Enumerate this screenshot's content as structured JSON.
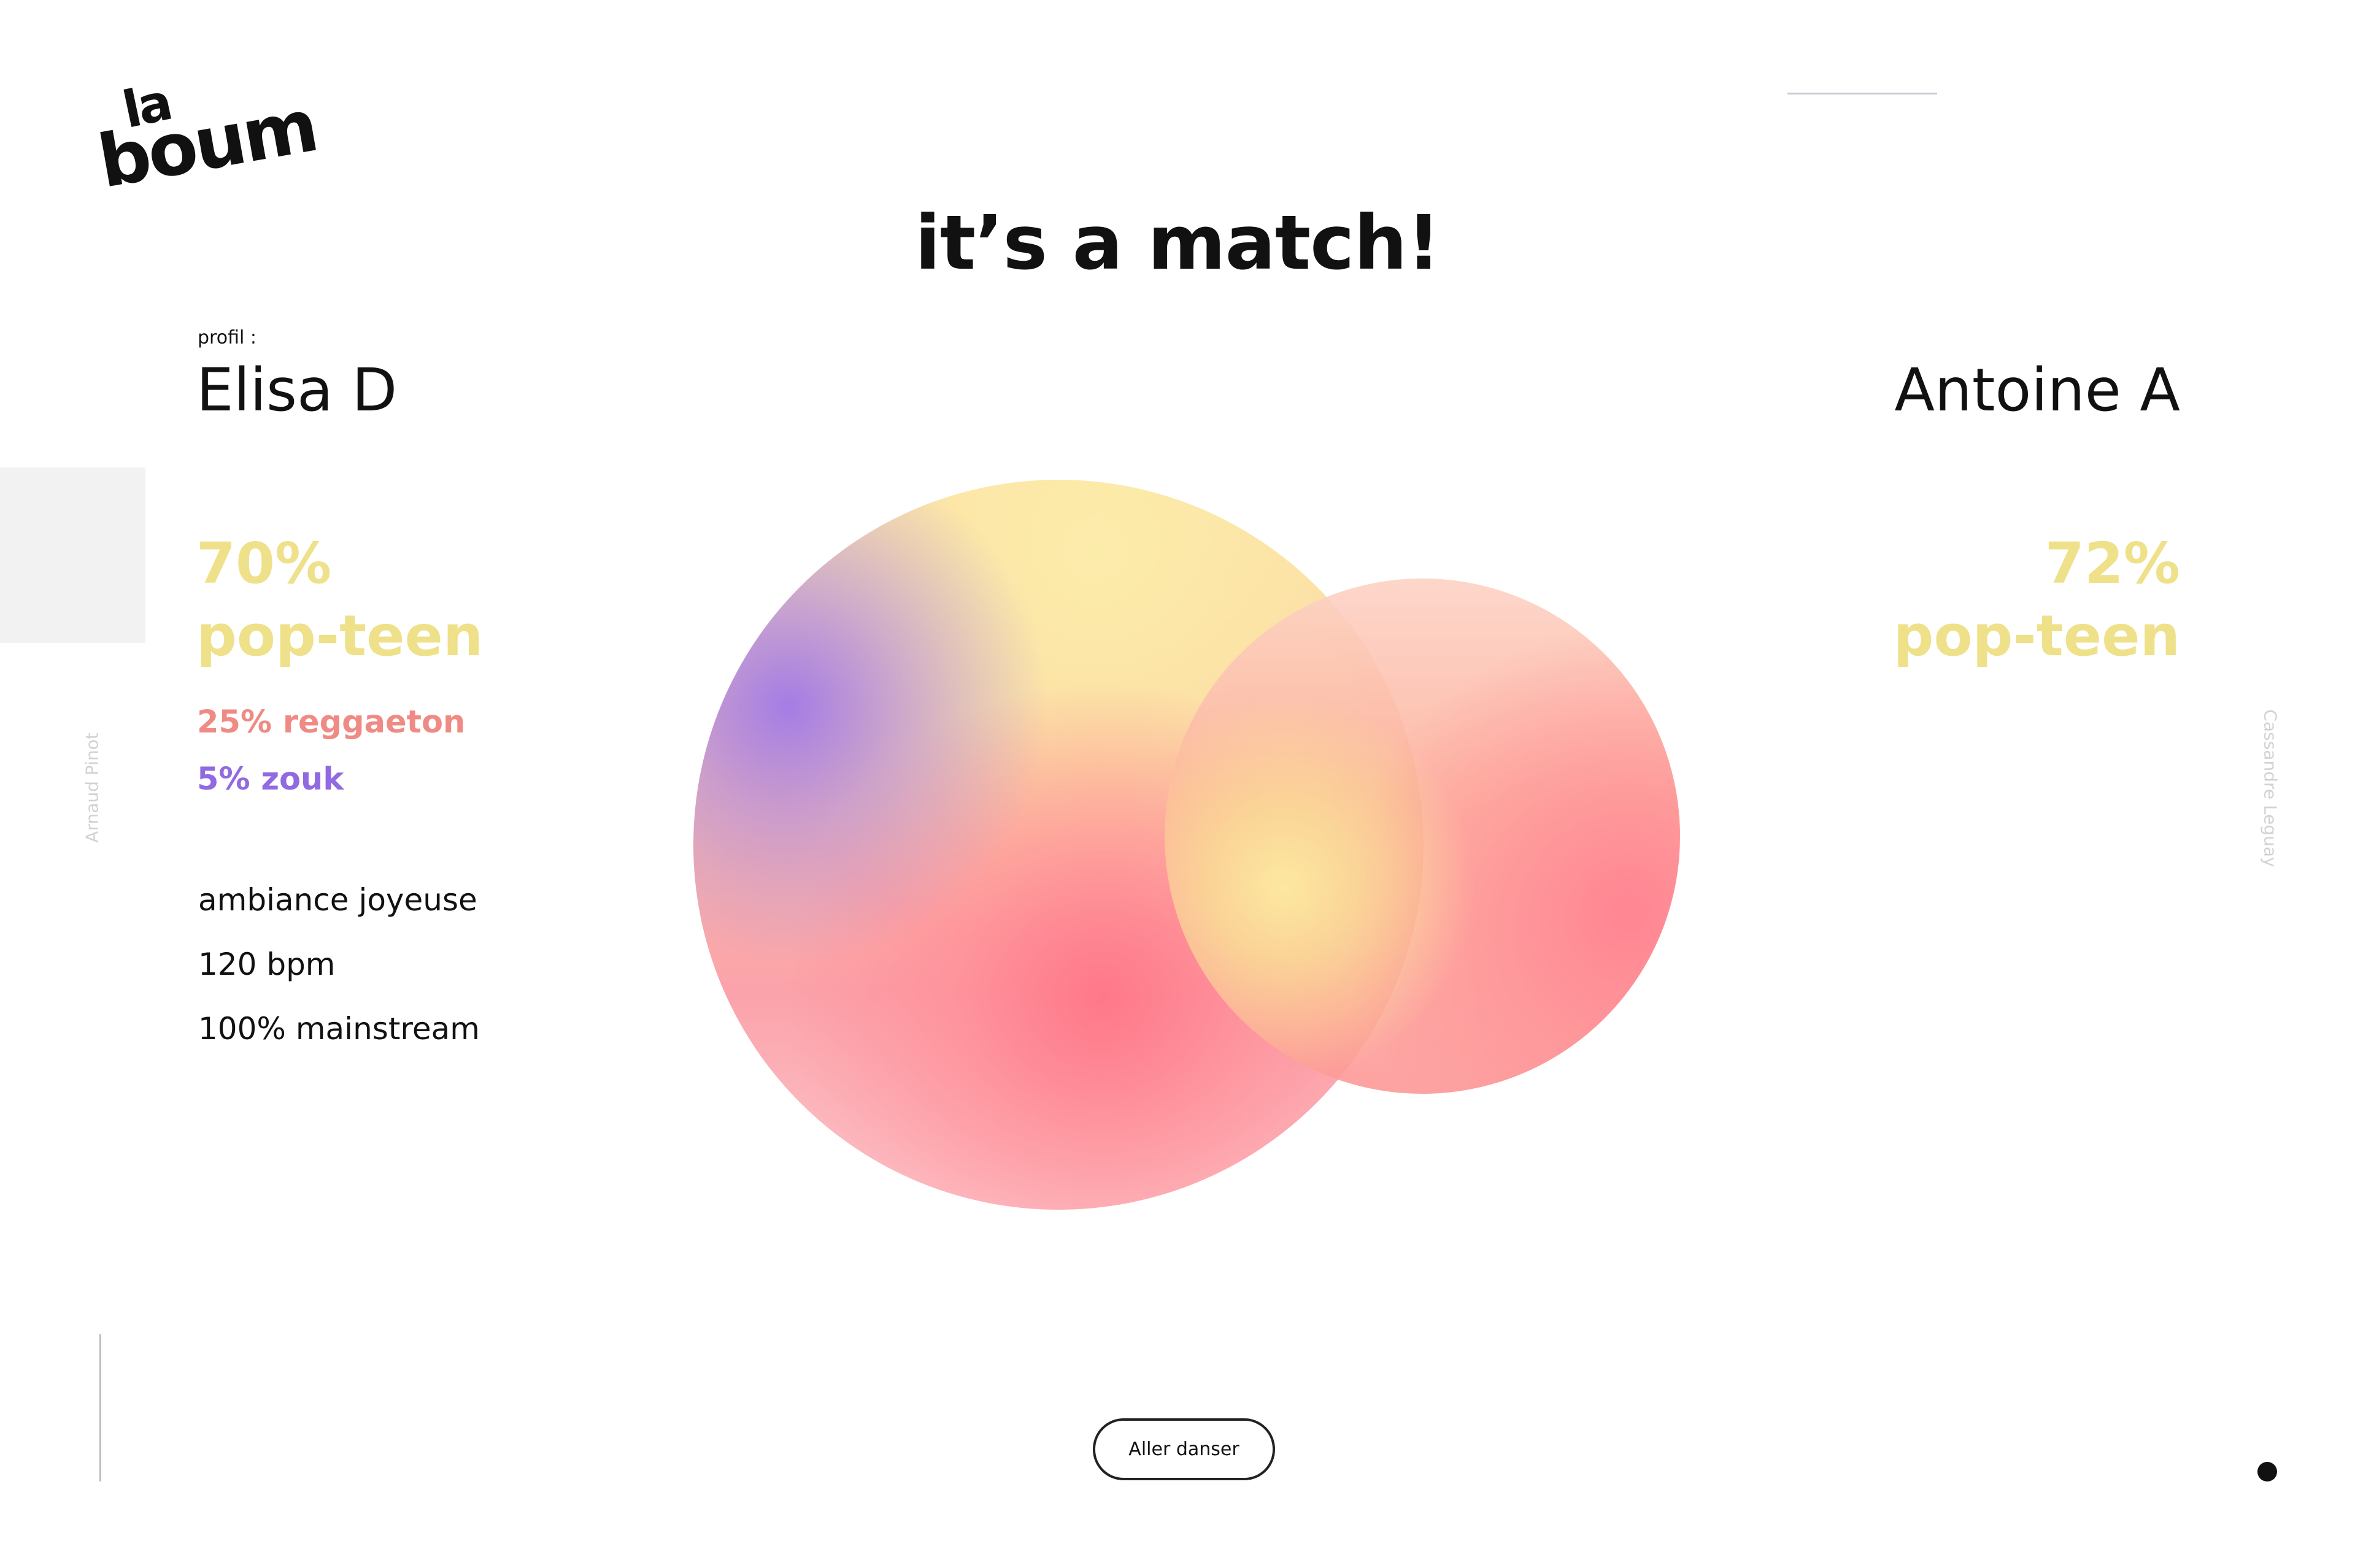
{
  "logo": {
    "line1": "la",
    "line2": "boum"
  },
  "title": "it’s a match!",
  "left_profile": {
    "label": "profil :",
    "name": "Elisa D",
    "main_percent": "70%",
    "main_genre": "pop-teen",
    "genre2": "25% reggaeton",
    "genre3": "5% zouk",
    "attributes": [
      "ambiance joyeuse",
      "120 bpm",
      "100% mainstream"
    ]
  },
  "right_profile": {
    "name": "Antoine A",
    "main_percent": "72%",
    "main_genre": "pop-teen"
  },
  "side_labels": {
    "left": "Arnaud Pinot",
    "right": "Cassandre Leguay"
  },
  "cta": {
    "label": "Aller danser"
  },
  "colors": {
    "popteen": "#efe08a",
    "reggaeton": "#f08a84",
    "zouk": "#9169e0",
    "text": "#111111"
  }
}
